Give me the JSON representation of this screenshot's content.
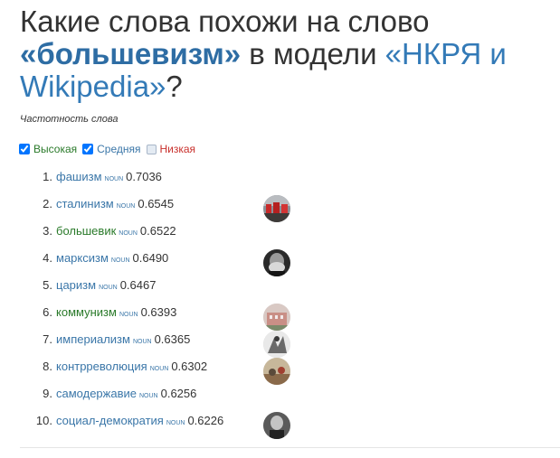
{
  "header": {
    "prefix": "Какие слова похожи на слово",
    "word": "«большевизм»",
    "middle": "в модели",
    "model": "«НКРЯ и Wikipedia»",
    "suffix": "?"
  },
  "frequency": {
    "label": "Частотность слова",
    "high": "Высокая",
    "medium": "Средняя",
    "low": "Низкая"
  },
  "results": [
    {
      "n": "1.",
      "word": "фашизм",
      "pos": "NOUN",
      "score": "0.7036"
    },
    {
      "n": "2.",
      "word": "сталинизм",
      "pos": "NOUN",
      "score": "0.6545"
    },
    {
      "n": "3.",
      "word": "большевик",
      "pos": "NOUN",
      "score": "0.6522"
    },
    {
      "n": "4.",
      "word": "марксизм",
      "pos": "NOUN",
      "score": "0.6490"
    },
    {
      "n": "5.",
      "word": "царизм",
      "pos": "NOUN",
      "score": "0.6467"
    },
    {
      "n": "6.",
      "word": "коммунизм",
      "pos": "NOUN",
      "score": "0.6393"
    },
    {
      "n": "7.",
      "word": "империализм",
      "pos": "NOUN",
      "score": "0.6365"
    },
    {
      "n": "8.",
      "word": "контрреволюция",
      "pos": "NOUN",
      "score": "0.6302"
    },
    {
      "n": "9.",
      "word": "самодержавие",
      "pos": "NOUN",
      "score": "0.6256"
    },
    {
      "n": "10.",
      "word": "социал-демократия",
      "pos": "NOUN",
      "score": "0.6226"
    }
  ],
  "colors": {
    "high": "#2a7a2a",
    "medium": "#3a76a8",
    "low": "#c9302c",
    "link": "#337ab7"
  }
}
